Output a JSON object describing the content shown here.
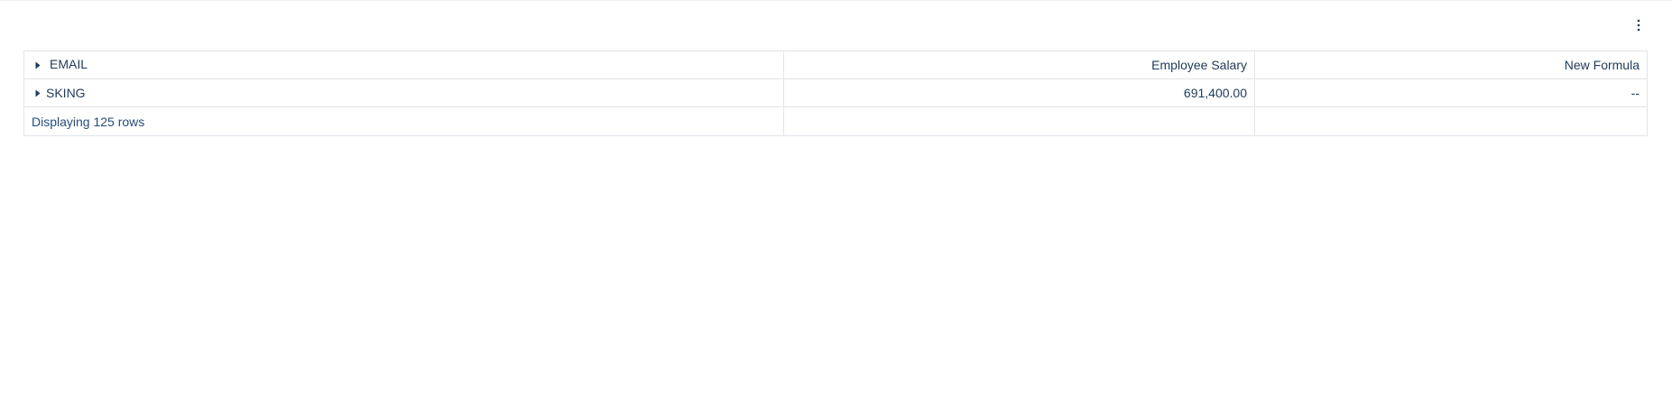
{
  "colors": {
    "text": "#1f3a5a",
    "grid_border": "#e1e5ea",
    "footer_text": "#264d7a"
  },
  "toolbar": {
    "menu_icon": "more-vertical-icon"
  },
  "table": {
    "columns": [
      {
        "label": "EMAIL",
        "expandable": true
      },
      {
        "label": "Employee Salary"
      },
      {
        "label": "New Formula"
      }
    ],
    "rows": [
      {
        "group": "SKING",
        "expandable": true,
        "salary": "691,400.00",
        "new_formula": "--"
      }
    ],
    "footer": {
      "text": "Displaying 125 rows"
    }
  }
}
